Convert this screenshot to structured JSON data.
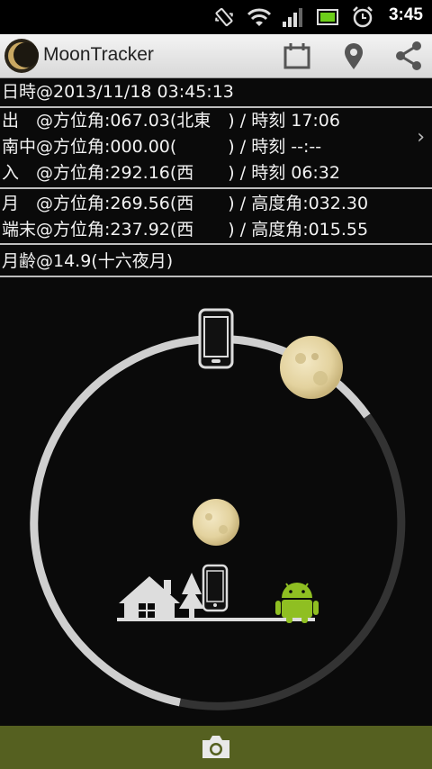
{
  "status": {
    "time": "3:45",
    "icons": [
      "vibrate-icon",
      "wifi-icon",
      "signal-icon",
      "battery-icon",
      "alarm-icon"
    ]
  },
  "app": {
    "title": "MoonTracker"
  },
  "actions": [
    "calendar-icon",
    "location-pin-icon",
    "share-icon"
  ],
  "datetime": "日時@2013/11/18 03:45:13",
  "events": [
    "出　@方位角:067.03(北東　) / 時刻 17:06",
    "南中@方位角:000.00(　　　) / 時刻 --:--",
    "入　@方位角:292.16(西　　) / 時刻 06:32"
  ],
  "positions": [
    "月　@方位角:269.56(西　　) / 高度角:032.30",
    "端末@方位角:237.92(西　　) / 高度角:015.55"
  ],
  "moon_age": "月齢@14.9(十六夜月)",
  "colors": {
    "action_bar": "#e8e8e8",
    "bottom_bar": "#556020",
    "ring_light": "#d0d0d0",
    "ring_dark": "#333333",
    "moon": "#e8d9a8",
    "android": "#8fbf22"
  }
}
